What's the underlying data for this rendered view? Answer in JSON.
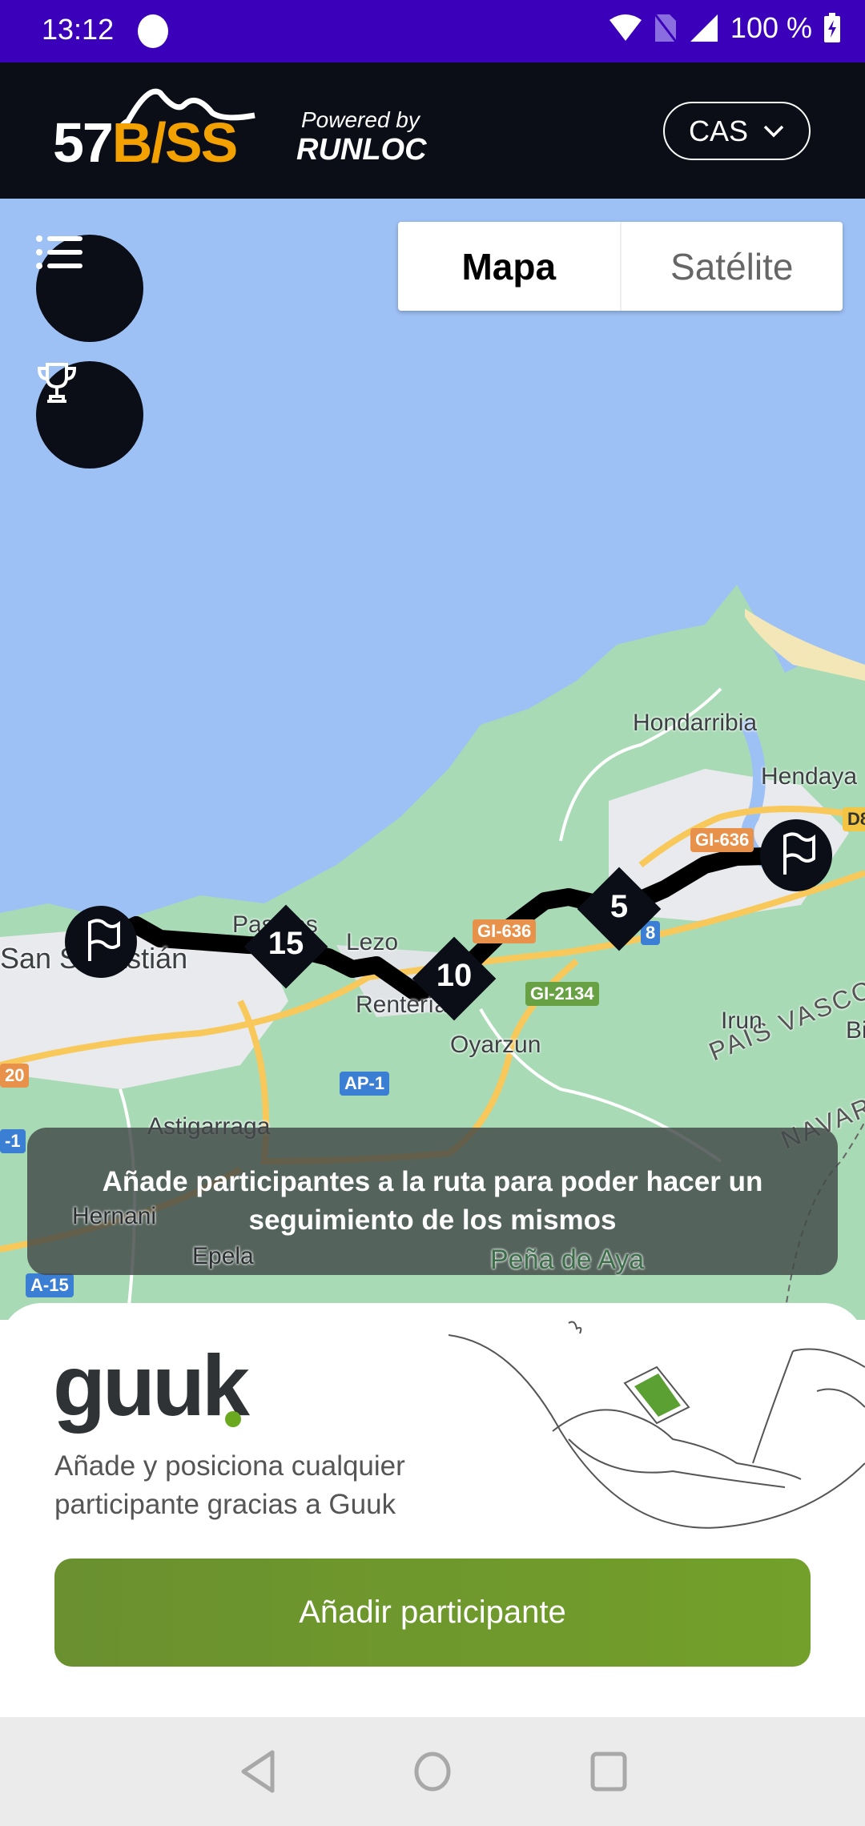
{
  "status_bar": {
    "time": "13:12",
    "battery": "100 %"
  },
  "header": {
    "logo_white": "57",
    "logo_orange": "B/SS",
    "powered_by": "Powered by",
    "partner": "RUNLOC",
    "language": "CAS"
  },
  "map": {
    "tabs": [
      {
        "label": "Mapa",
        "active": true
      },
      {
        "label": "Satélite",
        "active": false
      }
    ],
    "labels": [
      "Hondarribia",
      "Hendaya",
      "San Sebastián",
      "Lezo",
      "Rentería",
      "Oyarzun",
      "Astigarraga",
      "Hernani",
      "Epela",
      "Peña de Aya",
      "PAÍS VASCO",
      "NAVARRA",
      "Pasajes",
      "Irun",
      "Bi"
    ],
    "roads": [
      "GI-636",
      "GI-636",
      "GI-2134",
      "AP-1",
      "A-15",
      "D8",
      "-1",
      "20",
      "8"
    ],
    "markers": [
      "15",
      "10",
      "5"
    ],
    "colors": {
      "sea": "#9ec1f5",
      "land": "#a8dab5",
      "route": "#000000",
      "marker": "#0b0e16"
    }
  },
  "toast": "Añade participantes a la ruta para poder hacer un seguimiento de los mismos",
  "sheet": {
    "brand": "guuk",
    "description": "Añade y posiciona cualquier participante gracias a Guuk",
    "button": "Añadir participante",
    "accent": "#6b9a2e"
  }
}
